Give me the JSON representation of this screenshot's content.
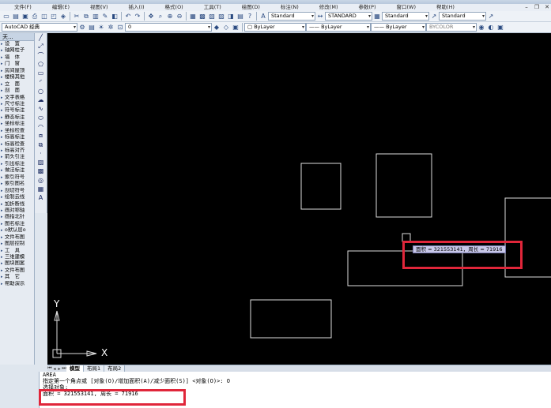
{
  "menu": [
    "文件(F)",
    "编辑(E)",
    "视图(V)",
    "插入(I)",
    "格式(O)",
    "工具(T)",
    "绘图(D)",
    "标注(N)",
    "修改(M)",
    "参数(P)",
    "窗口(W)",
    "帮助(H)"
  ],
  "toolbar1": {
    "text_style": "Standard",
    "dim_style": "STANDARD",
    "table_style": "Standard",
    "multileader_style": "Standard"
  },
  "toolbar2": {
    "workspace": "AutoCAD 经典",
    "layer": "0",
    "color": "ByLayer",
    "linetype": "ByLayer",
    "lineweight": "ByLayer",
    "plotstyle": "BYCOLOR"
  },
  "leftpanel": {
    "title": "天...",
    "items": [
      "设　置",
      "轴网柱子",
      "墙　体",
      "门　窗",
      "房间屋顶",
      "楼梯其他",
      "立　面",
      "剖　面",
      "文字表格",
      "尺寸标注",
      "符号标注",
      "静态标注",
      "坐标标注",
      "坐标检查",
      "标高标注",
      "标高检查",
      "标高对齐",
      "箭头引注",
      "引出标注",
      "做法标注",
      "索引符号",
      "索引图名",
      "剖切符号",
      "绘制云线",
      "加折断线",
      "画对称轴",
      "画指北针",
      "图名标注",
      "o默认层o",
      "文件布图",
      "图层控制",
      "工　具",
      "三维建模",
      "图块图案",
      "文件布图",
      "其　它",
      "帮助演示"
    ]
  },
  "drawtools": [
    "line",
    "construction-line",
    "polyline",
    "polygon",
    "rectangle",
    "arc",
    "circle",
    "revcloud",
    "spline",
    "ellipse",
    "ellipse-arc",
    "insert-block",
    "make-block",
    "point",
    "hatch",
    "gradient",
    "region",
    "table",
    "mtext"
  ],
  "tabs": {
    "model": "模型",
    "layout1": "布局1",
    "layout2": "布局2"
  },
  "command": {
    "line1": "AREA",
    "line2": "指定第一个角点或 [对象(O)/增加面积(A)/减少面积(S)] <对象(O)>: O",
    "line3": "选择对象:",
    "result": "面积 = 321553141, 周长 = 71916"
  },
  "tooltip": "面积 = 321553141，周长 = 71916",
  "ucs": {
    "y": "Y",
    "x": "X"
  },
  "colors": {
    "highlight": "#e0263a",
    "canvas": "#000000"
  }
}
